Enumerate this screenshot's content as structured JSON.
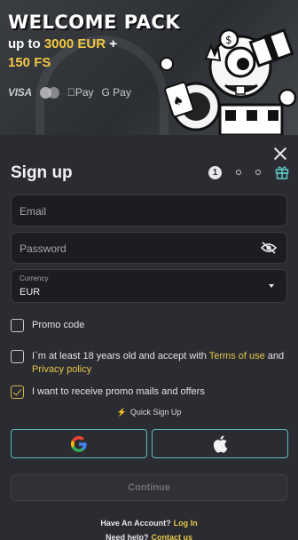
{
  "banner": {
    "title": "WELCOME PACK",
    "line1_prefix": "up to ",
    "line1_amount": "3000 EUR",
    "line1_suffix": " +",
    "line2": "150 FS",
    "payments": {
      "visa": "VISA",
      "apple_pay": "Pay",
      "google_pay": "G Pay"
    }
  },
  "form": {
    "title": "Sign up",
    "steps": [
      "1",
      "",
      ""
    ],
    "email": {
      "placeholder": "Email",
      "value": ""
    },
    "password": {
      "placeholder": "Password",
      "value": ""
    },
    "currency": {
      "label": "Currency",
      "value": "EUR"
    },
    "promo": {
      "label": "Promo code",
      "checked": false
    },
    "terms": {
      "text_before": "I`m at least 18 years old and accept with ",
      "terms_link": "Terms of use",
      "text_mid": " and ",
      "privacy_link": "Privacy policy",
      "checked": false
    },
    "newsletter": {
      "label": "I want to receive promo mails and offers",
      "checked": true
    },
    "quick_signup": "Quick Sign Up",
    "continue_label": "Continue",
    "have_account": "Have An Account?",
    "login_link": "Log In",
    "need_help": "Need help?",
    "contact_link": "Contact us"
  },
  "colors": {
    "accent": "#f3c843",
    "link": "#e6c64a",
    "social_border": "#5fbcbe",
    "panel": "#2a2c31",
    "bolt": "#e0533e"
  },
  "icons": [
    "close-icon",
    "gift-icon",
    "eye-off-icon",
    "chevron-down-icon",
    "google-icon",
    "apple-icon",
    "bolt-icon"
  ]
}
